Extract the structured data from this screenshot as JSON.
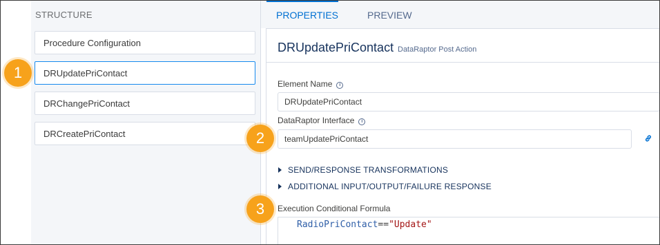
{
  "structure": {
    "title": "STRUCTURE",
    "steps": [
      {
        "label": "Procedure Configuration"
      },
      {
        "label": "DRUpdatePriContact"
      },
      {
        "label": "DRChangePriContact"
      },
      {
        "label": "DRCreatePriContact"
      }
    ],
    "selected_index": 1
  },
  "tabs": [
    {
      "label": "PROPERTIES",
      "active": true
    },
    {
      "label": "PREVIEW",
      "active": false
    }
  ],
  "element": {
    "name": "DRUpdatePriContact",
    "type": "DataRaptor Post Action"
  },
  "fields": {
    "element_name_label": "Element Name",
    "element_name_value": "DRUpdatePriContact",
    "interface_label": "DataRaptor Interface",
    "interface_value": "teamUpdatePriContact"
  },
  "sections": [
    {
      "label": "SEND/RESPONSE TRANSFORMATIONS"
    },
    {
      "label": "ADDITIONAL INPUT/OUTPUT/FAILURE RESPONSE"
    }
  ],
  "formula": {
    "label": "Execution Conditional Formula",
    "variable": "RadioPriContact",
    "operator": "==",
    "value": "\"Update\""
  },
  "callouts": [
    "1",
    "2",
    "3"
  ],
  "icons": {
    "info": "info-icon",
    "link": "link-icon",
    "caret": "caret-right-icon"
  },
  "colors": {
    "accent": "#0070d2",
    "callout": "#f7a21b",
    "selected_border": "#1589ee"
  }
}
